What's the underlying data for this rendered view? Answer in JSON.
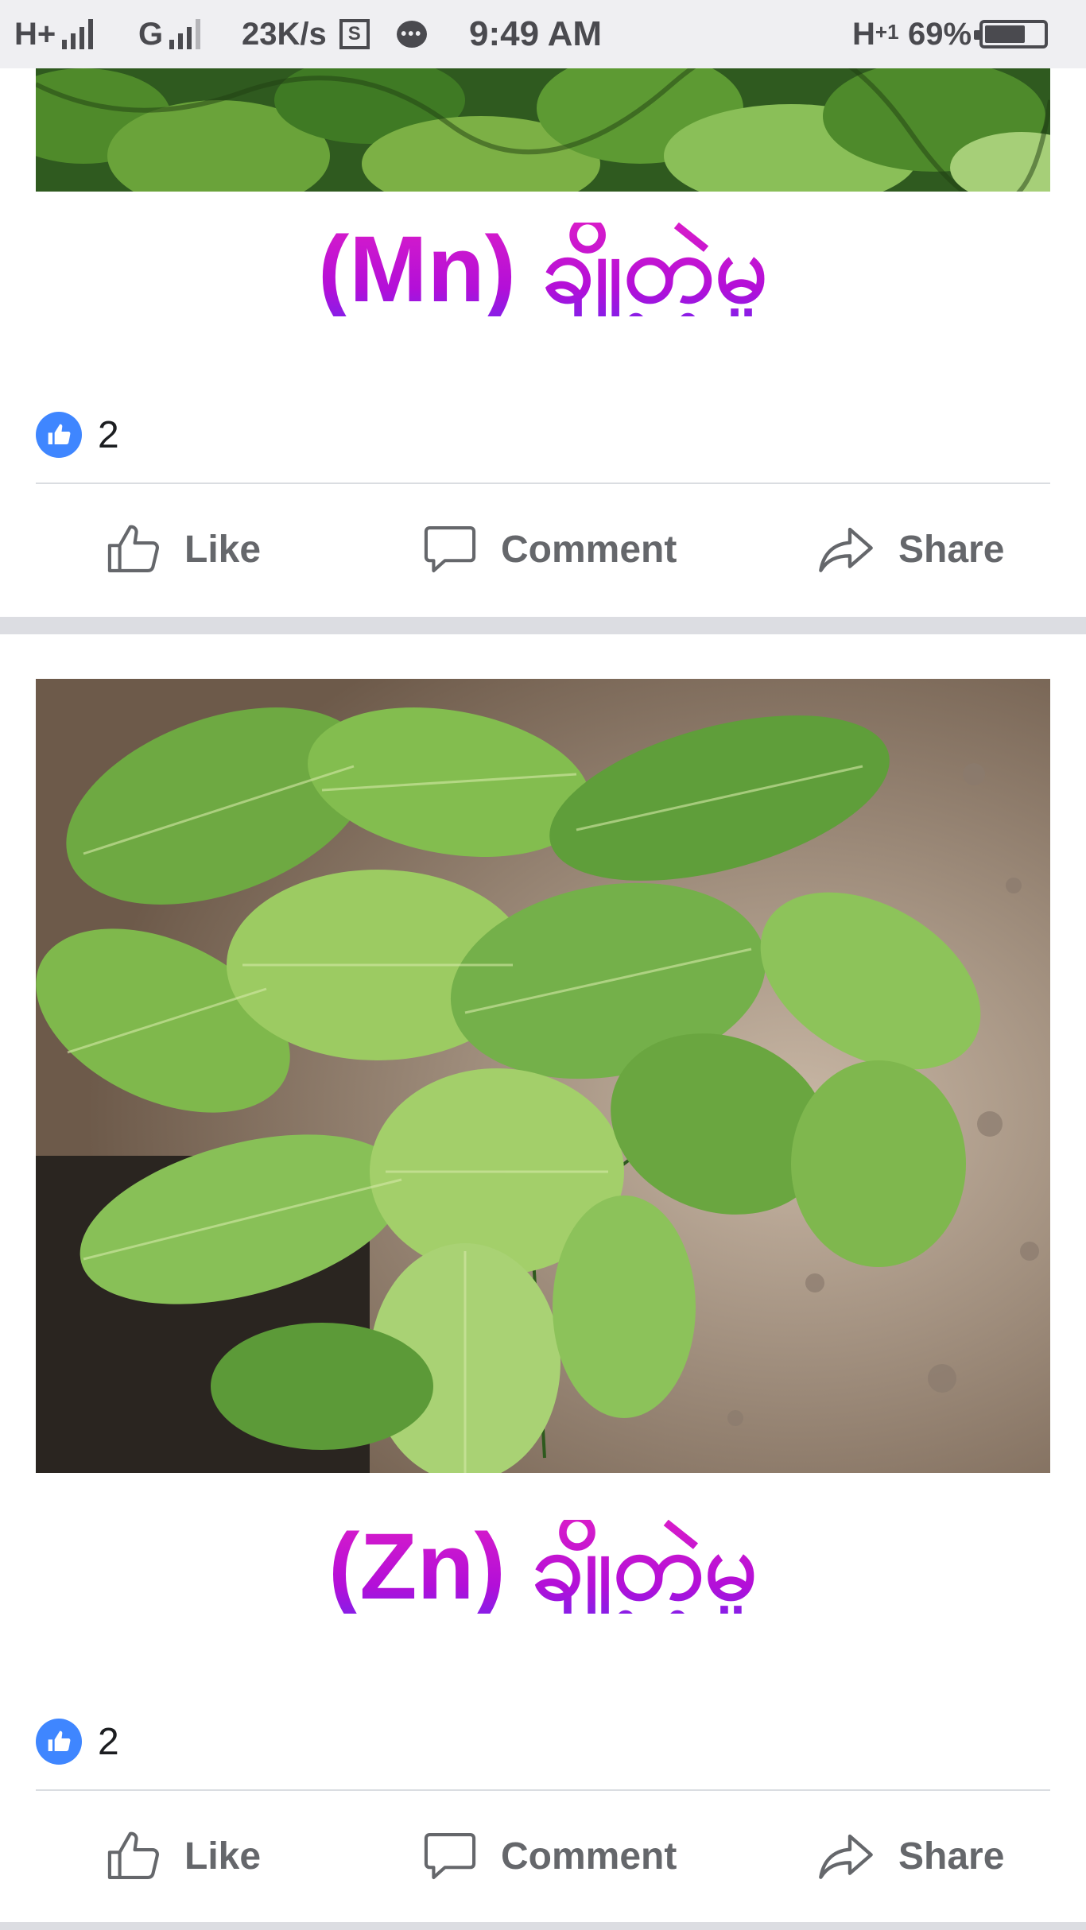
{
  "status_bar": {
    "network_1": "H+",
    "network_2": "G",
    "speed": "23K/s",
    "screenshot_icon": "S",
    "time": "9:49 AM",
    "network_3": "H",
    "network_3_sup": "+1",
    "battery": "69%",
    "battery_level": 0.69
  },
  "posts": [
    {
      "caption": "(Mn) ချို့တဲ့မှု",
      "reaction_count": "2",
      "actions": {
        "like": "Like",
        "comment": "Comment",
        "share": "Share"
      }
    },
    {
      "caption": "(Zn) ချို့တဲ့မှု",
      "reaction_count": "2",
      "actions": {
        "like": "Like",
        "comment": "Comment",
        "share": "Share"
      }
    }
  ],
  "icons": {
    "like": "thumbs-up-icon",
    "comment": "speech-bubble-icon",
    "share": "share-arrow-icon",
    "reaction": "like-reaction-icon"
  },
  "colors": {
    "facebook_blue": "#3f86ff",
    "caption_magenta": "#c21ad6",
    "action_gray": "#65676b"
  }
}
